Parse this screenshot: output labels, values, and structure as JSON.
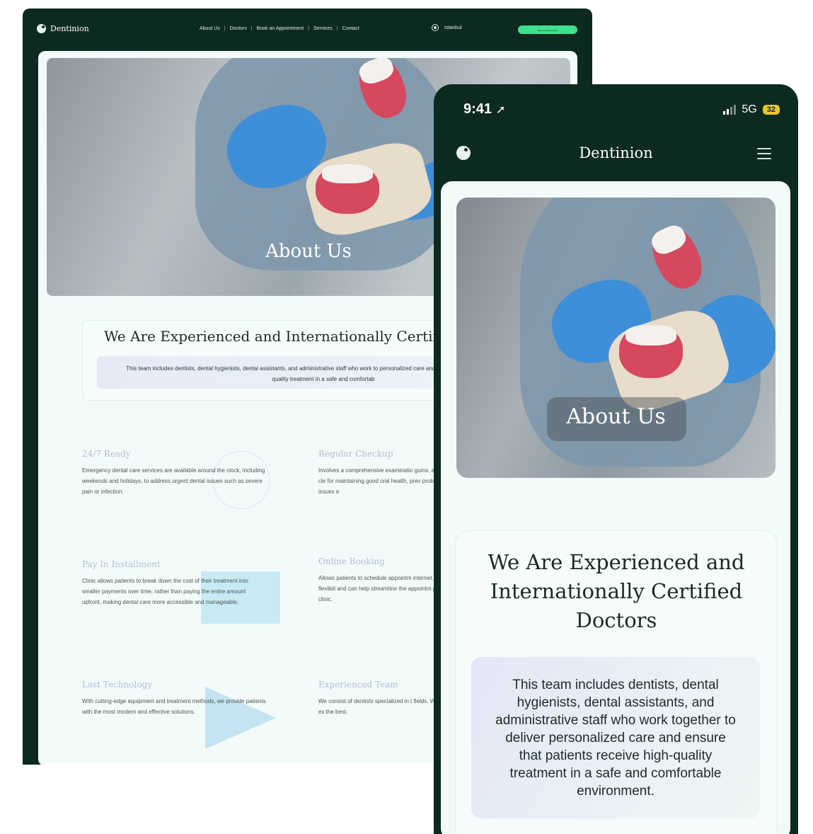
{
  "desktop": {
    "brand": "Dentinion",
    "nav": [
      "About Us",
      "Doctors",
      "Book an Appointment",
      "Services",
      "Contact"
    ],
    "location": "Istanbul",
    "cta": "Book an Appointment",
    "hero_title": "About Us",
    "heading": "We Are Experienced and Internationally Certif",
    "description": "This team includes dentists, dental hygienists, dental assistants, and administrative staff who work to personalized care and ensure that patients receive high-quality treatment in a safe and comfortab",
    "features": [
      {
        "title": "24/7 Ready",
        "text": "Emergency dental care services are available around the clock, including weekends and holidays, to address urgent dental issues such as severe pain or infection."
      },
      {
        "title": "Regular Checkup",
        "text": "Involves a comprehensive examinatio gums, and mouth, and a thorough cle for maintaining good oral health, prev problems, and detecting any issues e"
      },
      {
        "title": "Pay In Installment",
        "text": "Clinic allows patients to break down the cost of their treatment into smaller payments over time, rather than paying the entire amount upfront, making dental care more accessible and manageable."
      },
      {
        "title": "Online Booking",
        "text": "Allows patients to schedule appointm internet. This system provides flexibili and can help streamline the appointm process for the dental clinic."
      },
      {
        "title": "Last Technology",
        "text": "With cutting-edge equipment and treatment methods, we provide patients with the most modern and effective solutions."
      },
      {
        "title": "Experienced Team",
        "text": "We consist of dentists specialized in t fields. We utilize our expertise and ex the best."
      }
    ]
  },
  "phone": {
    "time": "9:41",
    "network": "5G",
    "battery": "32",
    "brand": "Dentinion",
    "hero_title": "About Us",
    "heading": "We Are Experienced and Internationally Certified Doctors",
    "description": "This team includes dentists, dental hygienists, dental assistants, and administrative staff who work together to deliver personalized care and ensure that patients receive high-quality treatment in a safe and comfortable environment."
  },
  "colors": {
    "dark_green": "#0d2a20",
    "accent_green": "#3fe08f",
    "card_bg": "#f3fbfa",
    "feature_title": "#aebfd3"
  }
}
